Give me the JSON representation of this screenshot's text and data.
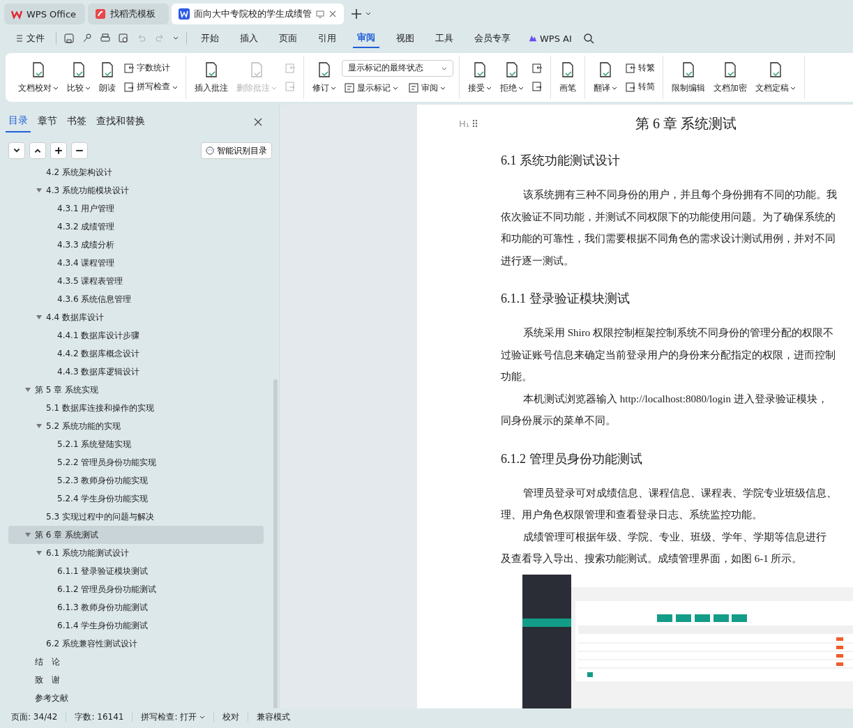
{
  "app_tabs": [
    {
      "label": "WPS Office",
      "kind": "home",
      "selected": false
    },
    {
      "label": "找稻壳模板",
      "kind": "template",
      "selected": false
    },
    {
      "label": "面向大中专院校的学生成绩管",
      "kind": "document",
      "selected": true
    }
  ],
  "menu": {
    "file": "文件",
    "quick_tools": [
      {
        "disabled": false
      },
      {
        "disabled": false
      },
      {
        "disabled": false
      },
      {
        "disabled": false
      },
      {
        "disabled": true
      },
      {
        "disabled": true
      }
    ],
    "tabs": [
      {
        "label": "开始",
        "selected": false
      },
      {
        "label": "插入",
        "selected": false
      },
      {
        "label": "页面",
        "selected": false
      },
      {
        "label": "引用",
        "selected": false
      },
      {
        "label": "审阅",
        "selected": true
      },
      {
        "label": "视图",
        "selected": false
      },
      {
        "label": "工具",
        "selected": false
      },
      {
        "label": "会员专享",
        "selected": false
      }
    ],
    "ai": "WPS AI"
  },
  "ribbon": [
    {
      "items": [
        {
          "kind": "big",
          "label": "文档校对",
          "dropdown": true,
          "disabled": false
        },
        {
          "kind": "big",
          "label": "比较",
          "dropdown": true,
          "disabled": false
        },
        {
          "kind": "big",
          "label": "朗读",
          "dropdown": false,
          "disabled": false
        },
        {
          "kind": "stack",
          "children": [
            {
              "label": "字数统计",
              "dropdown": false,
              "disabled": false
            },
            {
              "label": "拼写检查",
              "dropdown": true,
              "disabled": false
            }
          ]
        }
      ]
    },
    {
      "items": [
        {
          "kind": "big",
          "label": "插入批注",
          "dropdown": false,
          "disabled": false
        },
        {
          "kind": "big",
          "label": "删除批注",
          "dropdown": true,
          "disabled": true
        },
        {
          "kind": "stack",
          "children": [
            {
              "dropdown": false,
              "disabled": true
            },
            {
              "dropdown": false,
              "disabled": true
            }
          ]
        }
      ]
    },
    {
      "items": [
        {
          "kind": "big",
          "label": "修订",
          "dropdown": true,
          "disabled": false
        },
        {
          "kind": "panel",
          "select": "显示标记的最终状态",
          "children": [
            {
              "label": "显示标记",
              "dropdown": true,
              "disabled": false
            },
            {
              "label": "审阅",
              "dropdown": true,
              "disabled": false
            }
          ]
        }
      ]
    },
    {
      "items": [
        {
          "kind": "big",
          "label": "接受",
          "dropdown": true,
          "disabled": false
        },
        {
          "kind": "big",
          "label": "拒绝",
          "dropdown": true,
          "disabled": false
        },
        {
          "kind": "stack",
          "children": [
            {
              "dropdown": false,
              "disabled": false
            },
            {
              "dropdown": false,
              "disabled": false
            }
          ]
        }
      ]
    },
    {
      "items": [
        {
          "kind": "big",
          "label": "画笔",
          "dropdown": false,
          "disabled": false
        }
      ]
    },
    {
      "items": [
        {
          "kind": "big",
          "label": "翻译",
          "dropdown": true,
          "disabled": false
        },
        {
          "kind": "stack",
          "children": [
            {
              "label": "转繁",
              "dropdown": false,
              "disabled": false
            },
            {
              "label": "转简",
              "dropdown": false,
              "disabled": false
            }
          ]
        }
      ]
    },
    {
      "items": [
        {
          "kind": "big",
          "label": "限制编辑",
          "dropdown": false,
          "disabled": false
        },
        {
          "kind": "big",
          "label": "文档加密",
          "dropdown": false,
          "disabled": false
        },
        {
          "kind": "big",
          "label": "文档定稿",
          "dropdown": true,
          "disabled": false
        }
      ]
    }
  ],
  "nav": {
    "tabs": [
      {
        "label": "目录",
        "selected": true
      },
      {
        "label": "章节",
        "selected": false
      },
      {
        "label": "书签",
        "selected": false
      },
      {
        "label": "查找和替换",
        "selected": false
      }
    ],
    "smart_button": "智能识别目录",
    "toc": [
      {
        "children": [
          {
            "label": "4.2  系统架构设计",
            "selected": false
          },
          {
            "label": "4.3  系统功能模块设计",
            "selected": false,
            "expanded": true,
            "children": [
              {
                "label": "4.3.1  用户管理",
                "selected": false
              },
              {
                "label": "4.3.2  成绩管理",
                "selected": false
              },
              {
                "label": "4.3.3  成绩分析",
                "selected": false
              },
              {
                "label": "4.3.4  课程管理",
                "selected": false
              },
              {
                "label": "4.3.5  课程表管理",
                "selected": false
              },
              {
                "label": "4.3.6  系统信息管理",
                "selected": false
              }
            ]
          },
          {
            "label": "4.4  数据库设计",
            "selected": false,
            "expanded": true,
            "children": [
              {
                "label": "4.4.1  数据库设计步骤",
                "selected": false
              },
              {
                "label": "4.4.2  数据库概念设计",
                "selected": false
              },
              {
                "label": "4.4.3  数据库逻辑设计",
                "selected": false
              }
            ]
          }
        ]
      },
      {
        "label": "第 5 章  系统实现",
        "selected": false,
        "expanded": true,
        "children": [
          {
            "label": "5.1  数据库连接和操作的实现",
            "selected": false
          },
          {
            "label": "5.2  系统功能的实现",
            "selected": false,
            "expanded": true,
            "children": [
              {
                "label": "5.2.1  系统登陆实现",
                "selected": false
              },
              {
                "label": "5.2.2  管理员身份功能实现",
                "selected": false
              },
              {
                "label": "5.2.3  教师身份功能实现",
                "selected": false
              },
              {
                "label": "5.2.4  学生身份功能实现",
                "selected": false
              }
            ]
          },
          {
            "label": "5.3  实现过程中的问题与解决",
            "selected": false
          }
        ]
      },
      {
        "label": "第 6 章  系统测试",
        "selected": true,
        "expanded": true,
        "children": [
          {
            "label": "6.1  系统功能测试设计",
            "selected": false,
            "expanded": true,
            "children": [
              {
                "label": "6.1.1  登录验证模块测试",
                "selected": false
              },
              {
                "label": "6.1.2  管理员身份功能测试",
                "selected": false
              },
              {
                "label": "6.1.3  教师身份功能测试",
                "selected": false
              },
              {
                "label": "6.1.4  学生身份功能测试",
                "selected": false
              }
            ]
          },
          {
            "label": "6.2  系统兼容性测试设计",
            "selected": false
          }
        ]
      },
      {
        "label": "结　论",
        "selected": false
      },
      {
        "label": "致　谢",
        "selected": false
      },
      {
        "label": "参考文献",
        "selected": false
      }
    ]
  },
  "document": {
    "heading_marker": "H₁",
    "blocks": [
      {
        "kind": "chapter",
        "text": "第 6 章  系统测试"
      },
      {
        "kind": "section",
        "text": "6.1  系统功能测试设计"
      },
      {
        "kind": "paragraph",
        "lines": [
          "该系统拥有三种不同身份的用户，并且每个身份拥有不同的功能。我",
          "依次验证不同功能，并测试不同权限下的功能使用问题。为了确保系统的",
          "和功能的可靠性，我们需要根据不同角色的需求设计测试用例，并对不同",
          "进行逐一测试。"
        ]
      },
      {
        "kind": "section",
        "text": "6.1.1  登录验证模块测试"
      },
      {
        "kind": "paragraph",
        "lines": [
          "系统采用 Shiro 权限控制框架控制系统不同身份的管理分配的权限不",
          "过验证账号信息来确定当前登录用户的身份来分配指定的权限，进而控制",
          "功能。"
        ]
      },
      {
        "kind": "paragraph",
        "lines": [
          "本机测试浏览器输入 http://localhost:8080/login 进入登录验证模块，",
          "同身份展示的菜单不同。"
        ]
      },
      {
        "kind": "section",
        "text": "6.1.2  管理员身份功能测试"
      },
      {
        "kind": "paragraph",
        "lines": [
          "管理员登录可对成绩信息、课程信息、课程表、学院专业班级信息、",
          "理、用户角色权限管理和查看登录日志、系统监控功能。"
        ]
      },
      {
        "kind": "paragraph",
        "lines": [
          "成绩管理可根据年级、学院、专业、班级、学年、学期等信息进行",
          "及查看导入导出、搜索功能测试。成绩管理界面，如图 6-1 所示。"
        ]
      },
      {
        "kind": "figure"
      }
    ]
  },
  "status_bar": [
    {
      "text": "页面: 34/42",
      "dropdown": false
    },
    {
      "text": "字数: 16141",
      "dropdown": false
    },
    {
      "text": "拼写检查: 打开",
      "dropdown": true
    },
    {
      "text": "校对",
      "dropdown": false
    },
    {
      "text": "兼容模式",
      "dropdown": false
    }
  ]
}
